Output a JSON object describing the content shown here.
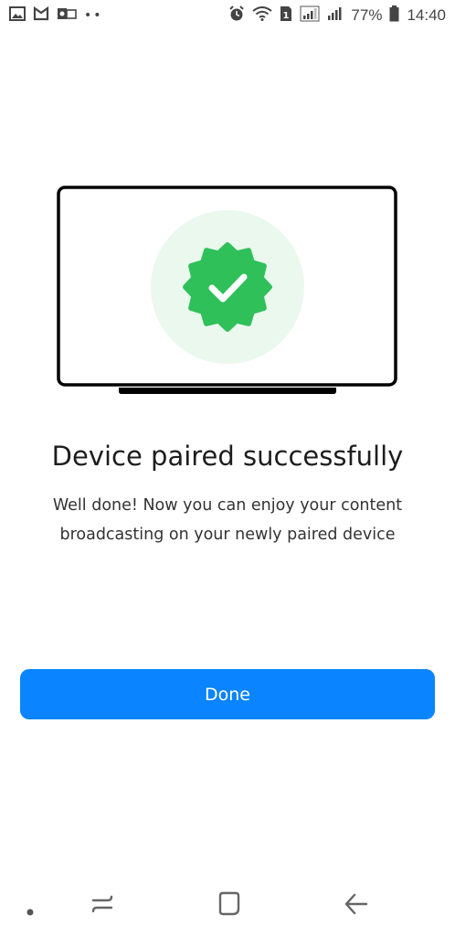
{
  "status_bar": {
    "battery_percent": "77%",
    "time": "14:40",
    "left_icons": [
      "gallery-icon",
      "mi-icon",
      "outlook-icon",
      "more-dots-icon"
    ],
    "right_icons": [
      "alarm-icon",
      "wifi-icon",
      "sim-icon",
      "signal-icon",
      "signal-icon",
      "battery-icon"
    ]
  },
  "illustration": {
    "icons": [
      "laptop-icon",
      "verified-badge-icon"
    ],
    "colors": {
      "badge": "#2fc05a",
      "halo": "#eaf8ee",
      "frame": "#000000"
    }
  },
  "content": {
    "title": "Device paired successfully",
    "subtitle_line1": "Well done! Now you can enjoy your content",
    "subtitle_line2": "broadcasting on your newly paired device"
  },
  "actions": {
    "done_label": "Done",
    "accent": "#0a84ff"
  },
  "nav_bar": {
    "icons": [
      "dot-icon",
      "recent-apps-icon",
      "home-icon",
      "back-icon"
    ]
  }
}
